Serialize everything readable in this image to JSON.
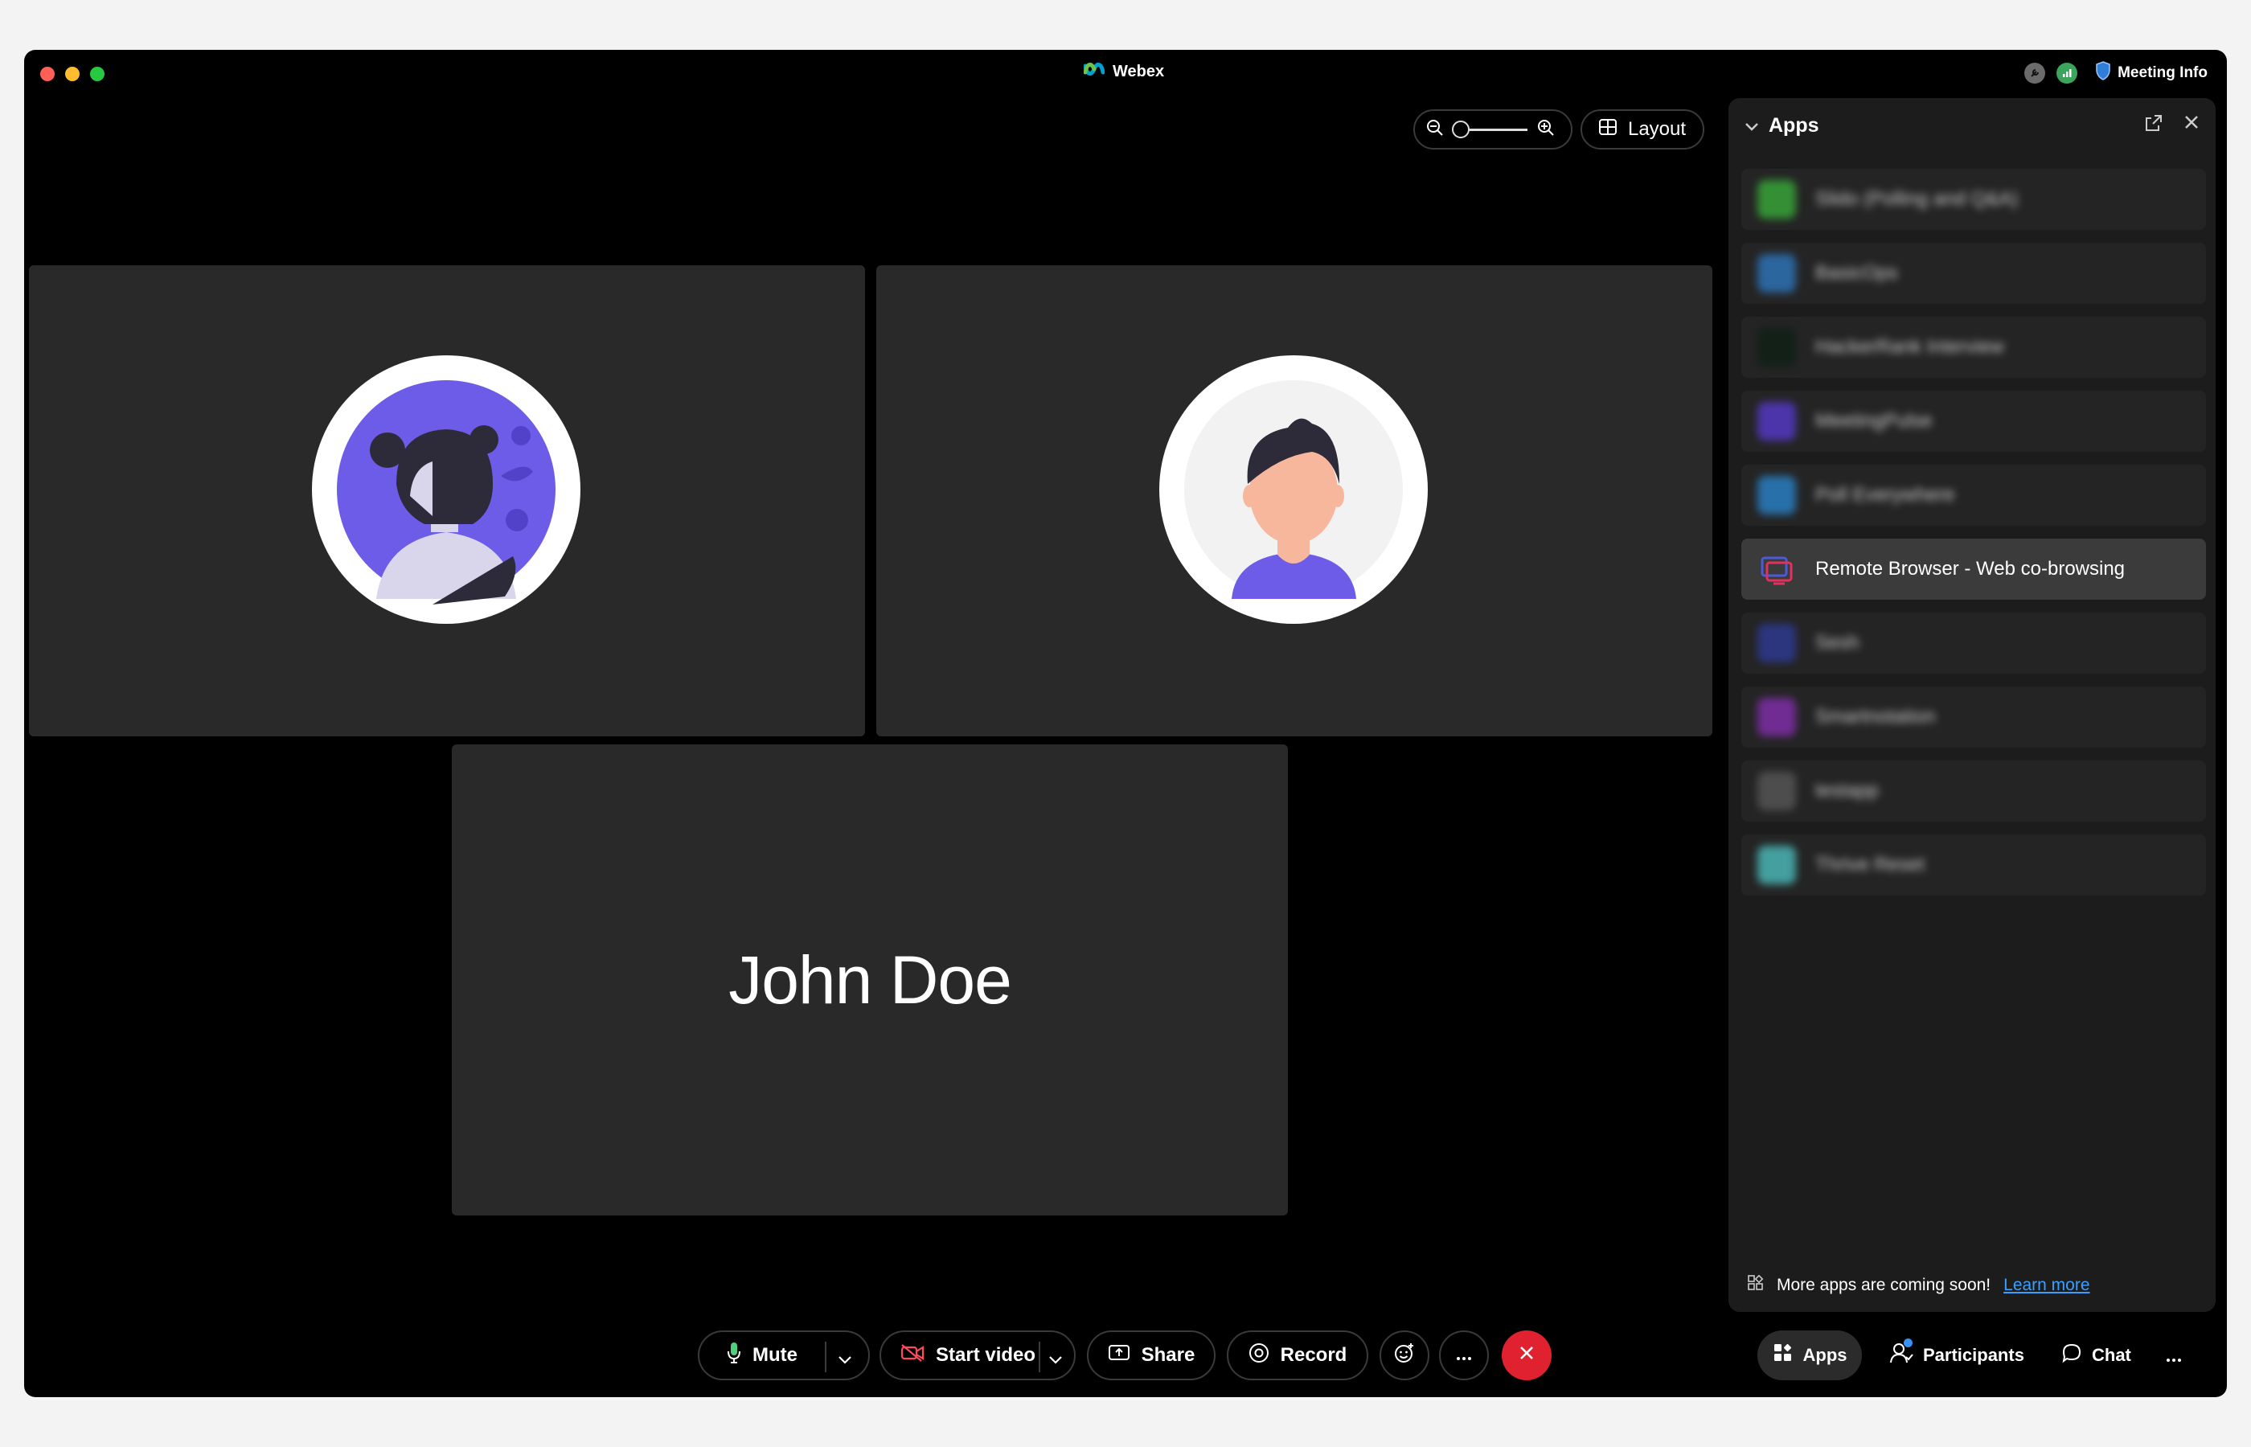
{
  "window": {
    "title": "Webex"
  },
  "topbar": {
    "meeting_info_label": "Meeting Info"
  },
  "toolbar": {
    "layout_label": "Layout"
  },
  "stage": {
    "participant_name": "John Doe"
  },
  "apps_panel": {
    "title": "Apps",
    "items": [
      {
        "label": "Slido (Polling and Q&A)",
        "icon": "slido-icon",
        "color": "#3bb53b",
        "blurred": true
      },
      {
        "label": "BasicOps",
        "icon": "basicops-icon",
        "color": "#2f7cc7",
        "blurred": true
      },
      {
        "label": "HackerRank Interview",
        "icon": "hackerrank-icon",
        "color": "#0d1f14",
        "blurred": true
      },
      {
        "label": "MeetingPulse",
        "icon": "meetingpulse-icon",
        "color": "#5a3bd8",
        "blurred": true
      },
      {
        "label": "Poll Everywhere",
        "icon": "polleverywhere-icon",
        "color": "#2a8ad6",
        "blurred": true
      },
      {
        "label": "Remote Browser - Web co-browsing",
        "icon": "remote-browser-icon",
        "color": "#e2305f",
        "blurred": false
      },
      {
        "label": "Sesh",
        "icon": "sesh-icon",
        "color": "#2e3d9e",
        "blurred": true
      },
      {
        "label": "Smartnotation",
        "icon": "smartnotation-icon",
        "color": "#8a2fb8",
        "blurred": true
      },
      {
        "label": "testapp",
        "icon": "testapp-icon",
        "color": "#5b5b5b",
        "blurred": true
      },
      {
        "label": "Thrive Reset",
        "icon": "thrive-reset-icon",
        "color": "#4fc8c8",
        "blurred": true
      }
    ],
    "footer_text": "More apps are coming soon!",
    "learn_more_label": "Learn more"
  },
  "controls": {
    "mute_label": "Mute",
    "video_label": "Start video",
    "share_label": "Share",
    "record_label": "Record",
    "end_color": "#e0212f"
  },
  "tabs": {
    "apps_label": "Apps",
    "participants_label": "Participants",
    "chat_label": "Chat"
  }
}
